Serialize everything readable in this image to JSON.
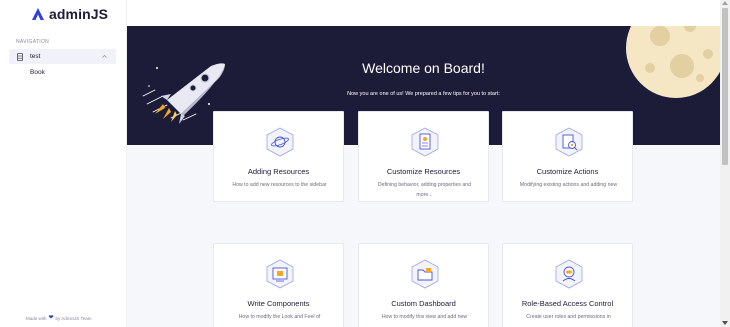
{
  "brand": {
    "name": "adminJS",
    "color": "#3040D6"
  },
  "sidebar": {
    "heading": "NAVIGATION",
    "group": {
      "label": "test",
      "icon": "database-icon",
      "expanded": true
    },
    "items": [
      {
        "label": "Book"
      }
    ],
    "footer": {
      "prefix": "Made with",
      "suffix": "by AdminJS Team",
      "icon": "heart-icon"
    }
  },
  "hero": {
    "title": "Welcome on Board!",
    "subtitle": "Now you are one of us! We prepared a few tips for you to start:",
    "background": "#1C1C38"
  },
  "cards": [
    {
      "title": "Adding Resources",
      "description": "How to add new resources to the sidebar",
      "icon": "planet-icon"
    },
    {
      "title": "Customize Resources",
      "description": "Defining behavior, adding properties and more...",
      "icon": "document-icon"
    },
    {
      "title": "Customize Actions",
      "description": "Modifying existing actions and adding new",
      "icon": "magnifier-document-icon"
    },
    {
      "title": "Write Components",
      "description": "How to modify the Look and Feel of",
      "icon": "components-icon"
    },
    {
      "title": "Custom Dashboard",
      "description": "How to modify this view and add new",
      "icon": "folder-icon"
    },
    {
      "title": "Role-Based Access Control",
      "description": "Create user roles and permissions in",
      "icon": "astronaut-icon"
    }
  ]
}
